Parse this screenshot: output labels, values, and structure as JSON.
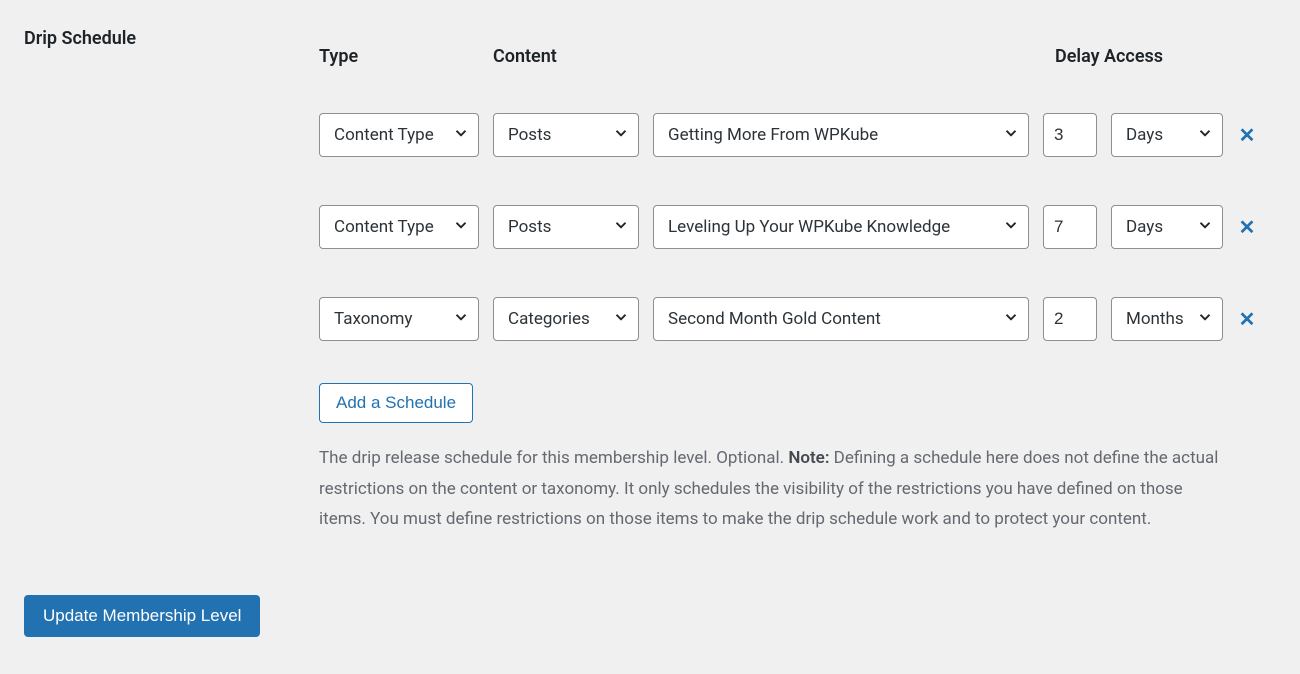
{
  "section_title": "Drip Schedule",
  "columns": {
    "type": "Type",
    "content": "Content",
    "delay": "Delay Access"
  },
  "rows": [
    {
      "type": "Content Type",
      "subtype": "Posts",
      "target": "Getting More From WPKube",
      "amount": "3",
      "unit": "Days"
    },
    {
      "type": "Content Type",
      "subtype": "Posts",
      "target": "Leveling Up Your WPKube Knowledge",
      "amount": "7",
      "unit": "Days"
    },
    {
      "type": "Taxonomy",
      "subtype": "Categories",
      "target": "Second Month Gold Content",
      "amount": "2",
      "unit": "Months"
    }
  ],
  "add_button": "Add a Schedule",
  "description_pre": "The drip release schedule for this membership level. Optional. ",
  "description_note_label": "Note:",
  "description_post": " Defining a schedule here does not define the actual restrictions on the content or taxonomy. It only schedules the visibility of the restrictions you have defined on those items. You must define restrictions on those items to make the drip schedule work and to protect your content.",
  "submit_button": "Update Membership Level",
  "remove_glyph": "✕"
}
